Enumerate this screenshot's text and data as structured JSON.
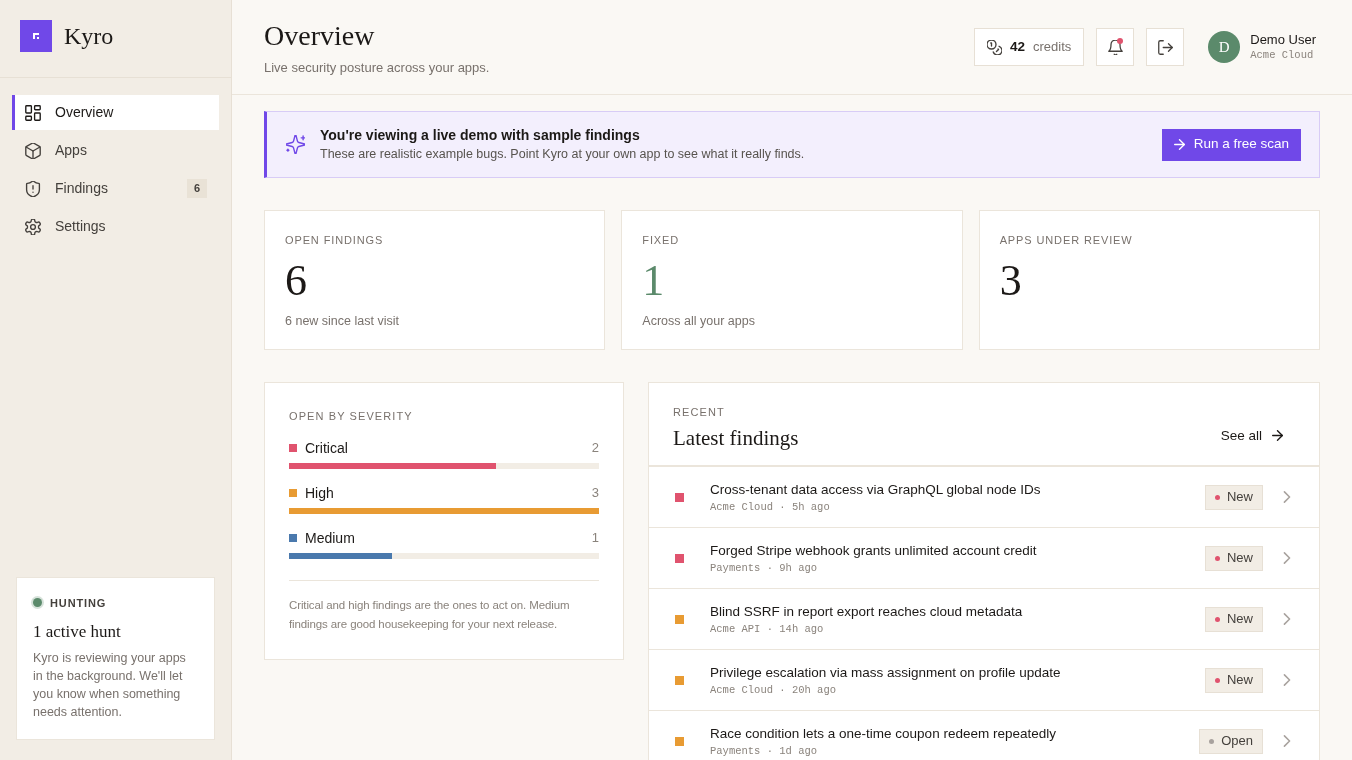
{
  "sidebar": {
    "brand": "Kyro",
    "nav": [
      {
        "label": "Overview",
        "selected": true
      },
      {
        "label": "Apps",
        "selected": false
      },
      {
        "label": "Findings",
        "selected": false,
        "badge": "6"
      },
      {
        "label": "Settings",
        "selected": false
      }
    ],
    "hunt_card": {
      "active": true,
      "status": "HUNTING",
      "title": "1 active hunt",
      "text": "Kyro is reviewing your apps in the background. We'll let you know when something needs attention."
    }
  },
  "header": {
    "title": "Overview",
    "subtitle": "Live security posture across your apps.",
    "credits": {
      "count": "42",
      "label": "credits"
    },
    "notifications": {
      "unread": true
    },
    "user": {
      "initial": "D",
      "name": "Demo User",
      "org": "Acme Cloud"
    }
  },
  "banner": {
    "title": "You're viewing a live demo with sample findings",
    "text": "These are realistic example bugs. Point Kyro at your own app to see what it really finds.",
    "button": "Run a free scan"
  },
  "stats": [
    {
      "label": "OPEN FINDINGS",
      "value": "6",
      "note": "6 new since last visit",
      "color": "#1c1917"
    },
    {
      "label": "FIXED",
      "value": "1",
      "note": "Across all your apps",
      "color": "#5b8a6b"
    },
    {
      "label": "APPS UNDER REVIEW",
      "value": "3",
      "color": "#1c1917"
    }
  ],
  "severity": {
    "title": "OPEN BY SEVERITY",
    "rows": [
      {
        "name": "Critical",
        "count": "2",
        "level": 0.667,
        "color": "#e0536e"
      },
      {
        "name": "High",
        "count": "3",
        "level": 1,
        "color": "#e89b33"
      },
      {
        "name": "Medium",
        "count": "1",
        "level": 0.333,
        "color": "#4a79ad"
      }
    ],
    "note": "Critical and high findings are the ones to act on. Medium findings are good housekeeping for your next release."
  },
  "recent": {
    "eyebrow": "RECENT",
    "title": "Latest findings",
    "link": "See all",
    "rows": [
      {
        "title": "Cross-tenant data access via GraphQL global node IDs",
        "meta": "Acme Cloud · 5h ago",
        "color": "#e0536e",
        "status": {
          "label": "New",
          "color": "#e0536e"
        }
      },
      {
        "title": "Forged Stripe webhook grants unlimited account credit",
        "meta": "Payments · 9h ago",
        "color": "#e0536e",
        "status": {
          "label": "New",
          "color": "#e0536e"
        }
      },
      {
        "title": "Blind SSRF in report export reaches cloud metadata",
        "meta": "Acme API · 14h ago",
        "color": "#e89b33",
        "status": {
          "label": "New",
          "color": "#e0536e"
        }
      },
      {
        "title": "Privilege escalation via mass assignment on profile update",
        "meta": "Acme Cloud · 20h ago",
        "color": "#e89b33",
        "status": {
          "label": "New",
          "color": "#e0536e"
        }
      },
      {
        "title": "Race condition lets a one-time coupon redeem repeatedly",
        "meta": "Payments · 1d ago",
        "color": "#e89b33",
        "status": {
          "label": "Open",
          "color": "#a8a29e"
        }
      }
    ]
  }
}
